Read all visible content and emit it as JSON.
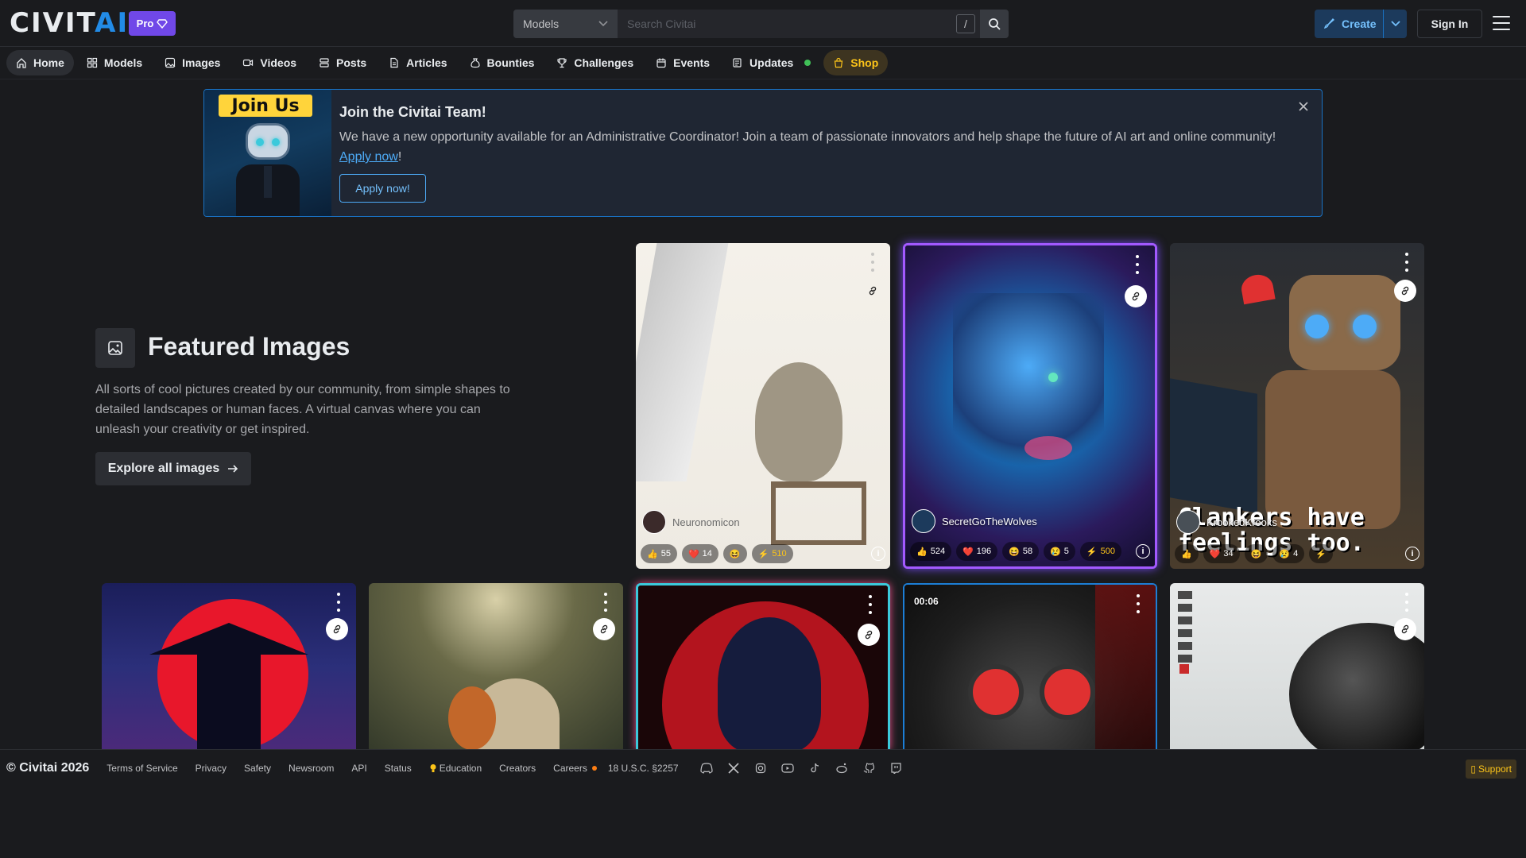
{
  "header": {
    "logo_main": "CIVIT",
    "logo_accent": "AI",
    "pro_label": "Pro",
    "search_category": "Models",
    "search_placeholder": "Search Civitai",
    "search_shortcut": "/",
    "create_label": "Create",
    "signin_label": "Sign In"
  },
  "nav": {
    "items": [
      {
        "label": "Home",
        "icon": "home-icon"
      },
      {
        "label": "Models",
        "icon": "grid-icon"
      },
      {
        "label": "Images",
        "icon": "photo-icon"
      },
      {
        "label": "Videos",
        "icon": "video-icon"
      },
      {
        "label": "Posts",
        "icon": "stack-icon"
      },
      {
        "label": "Articles",
        "icon": "file-icon"
      },
      {
        "label": "Bounties",
        "icon": "moneybag-icon"
      },
      {
        "label": "Challenges",
        "icon": "trophy-icon"
      },
      {
        "label": "Events",
        "icon": "calendar-icon"
      },
      {
        "label": "Updates",
        "icon": "news-icon"
      },
      {
        "label": "Shop",
        "icon": "bag-icon"
      }
    ]
  },
  "banner": {
    "image_label": "Join Us",
    "title": "Join the Civitai Team!",
    "text": "We have a new opportunity available for an Administrative Coordinator! Join a team of passionate innovators and help shape the future of AI art and online community! ",
    "link_text": "Apply now",
    "text_end": "!",
    "button": "Apply now!"
  },
  "featured": {
    "title": "Featured Images",
    "description": "All sorts of cool pictures created by our community, from simple shapes to detailed landscapes or human faces. A virtual canvas where you can unleash your creativity or get inspired.",
    "button": "Explore all images"
  },
  "cards": [
    {
      "user": "Neuronomicon",
      "likes": "55",
      "hearts": "14",
      "laughs": "",
      "buzz": "510"
    },
    {
      "user": "SecretGoTheWolves",
      "likes": "524",
      "hearts": "196",
      "laughs": "58",
      "sad": "5",
      "buzz": "500"
    },
    {
      "user": "KrookedKrooks",
      "likes": "",
      "hearts": "34",
      "laughs": "",
      "sad": "4",
      "buzz": "",
      "caption": "Clankers have feelings too."
    },
    {
      "duration": "00:06"
    }
  ],
  "footer": {
    "copyright": "© Civitai 2026",
    "links": [
      "Terms of Service",
      "Privacy",
      "Safety",
      "Newsroom",
      "API",
      "Status",
      "Education",
      "Creators",
      "Careers",
      "18 U.S.C. §2257"
    ],
    "support": "Support"
  },
  "colors": {
    "accent": "#228be6",
    "pro": "#7048e8",
    "shop": "#fcc419",
    "background": "#1a1b1e"
  }
}
